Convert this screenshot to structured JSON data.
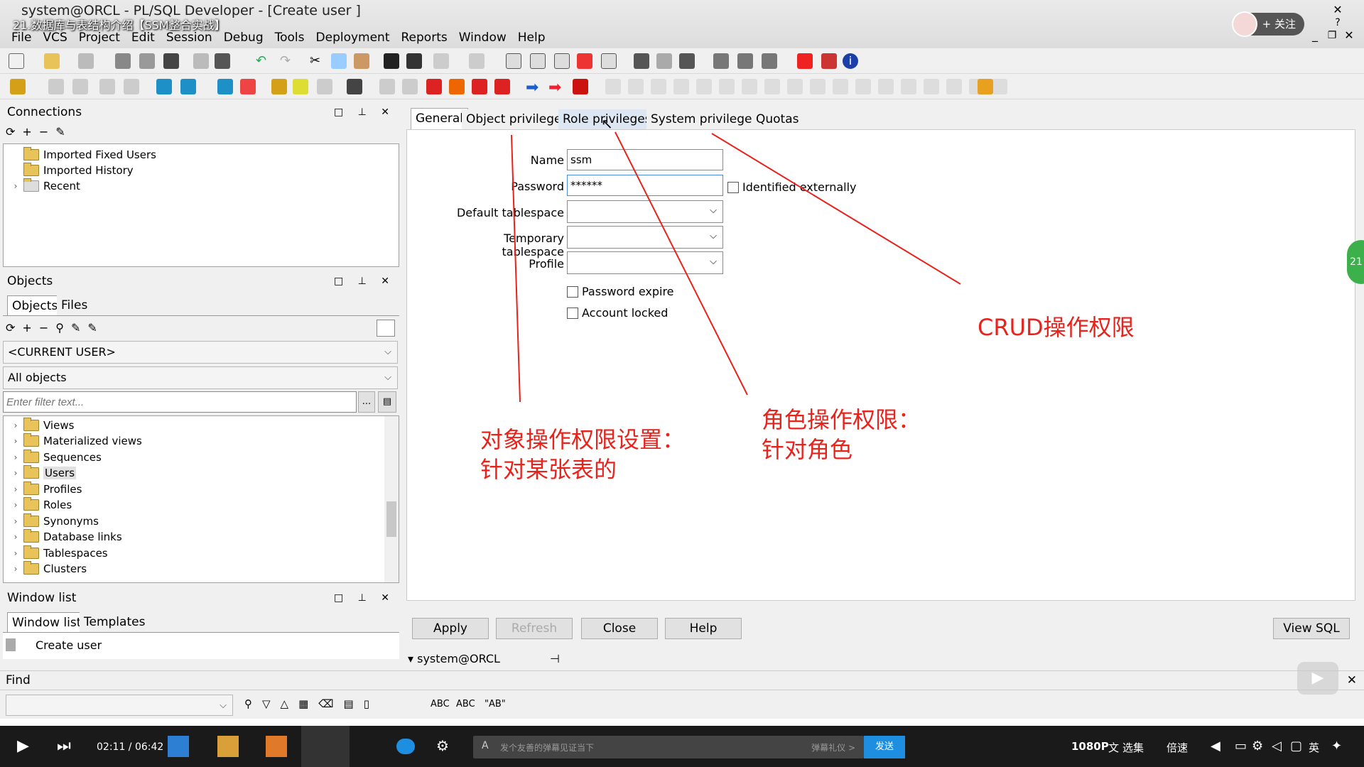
{
  "window": {
    "title": "system@ORCL - PL/SQL Developer - [Create user ]",
    "overlay_title": "21.数据库与表结构介绍【SSM整合实战】",
    "follow_label": "+ 关注"
  },
  "menu": [
    "File",
    "VCS",
    "Project",
    "Edit",
    "Session",
    "Debug",
    "Tools",
    "Deployment",
    "Reports",
    "Window",
    "Help"
  ],
  "connections": {
    "title": "Connections",
    "items": [
      "Imported Fixed Users",
      "Imported History",
      "Recent"
    ]
  },
  "objects": {
    "title": "Objects",
    "tabs": [
      "Objects",
      "Files"
    ],
    "user_select": "<CURRENT USER>",
    "type_select": "All objects",
    "filter_placeholder": "Enter filter text...",
    "filter_btn": "...",
    "items": [
      "Views",
      "Materialized views",
      "Sequences",
      "Users",
      "Profiles",
      "Roles",
      "Synonyms",
      "Database links",
      "Tablespaces",
      "Clusters"
    ],
    "selected": "Users"
  },
  "window_list": {
    "title": "Window list",
    "tabs": [
      "Window list",
      "Templates"
    ],
    "items": [
      "Create user"
    ]
  },
  "editor": {
    "tabs": [
      "General",
      "Object privileges",
      "Role privileges",
      "System privileges",
      "Quotas"
    ],
    "active_tab": "General",
    "form": {
      "name_label": "Name",
      "name_value": "ssm",
      "password_label": "Password",
      "password_value": "******",
      "identified_externally": "Identified externally",
      "default_ts_label": "Default tablespace",
      "temp_ts_label": "Temporary tablespace",
      "profile_label": "Profile",
      "password_expire": "Password expire",
      "account_locked": "Account locked"
    },
    "buttons": {
      "apply": "Apply",
      "refresh": "Refresh",
      "close": "Close",
      "help": "Help",
      "view_sql": "View SQL"
    },
    "connection": "system@ORCL"
  },
  "annotations": {
    "object": "对象操作权限设置：\n针对某张表的",
    "role": "角色操作权限：\n针对角色",
    "crud": "CRUD操作权限"
  },
  "find": {
    "title": "Find"
  },
  "badge": "21",
  "taskbar": {
    "time": "02:11 / 06:42",
    "danmaku_placeholder": "发个友善的弹幕见证当下",
    "danmaku_etiquette": "弹幕礼仪 >",
    "send": "发送",
    "quality": "1080P",
    "subtitle": "文",
    "episodes": "选集",
    "speed": "倍速",
    "lang": "英"
  }
}
